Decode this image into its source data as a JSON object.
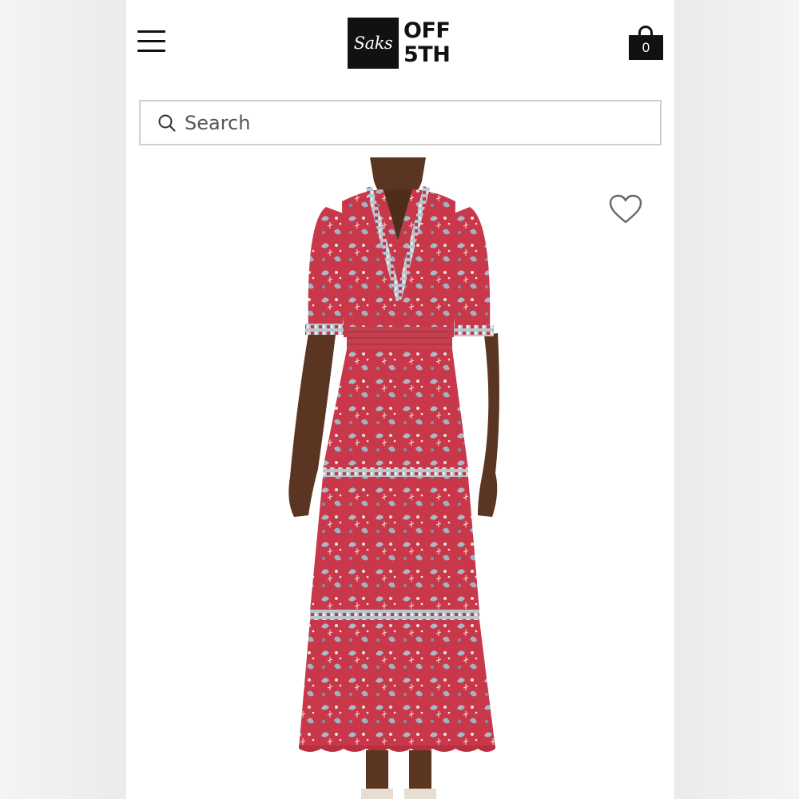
{
  "brand": {
    "logo_script": "Saks",
    "logo_line1": "OFF",
    "logo_line2": "5TH"
  },
  "header": {
    "menu_icon": "hamburger-menu-icon",
    "bag_icon": "shopping-bag-icon",
    "bag_count": "0"
  },
  "search": {
    "icon": "search-icon",
    "placeholder": "Search"
  },
  "product": {
    "favorite_icon": "heart-outline-icon",
    "image_subject": "model wearing a red floral tiered ruffle maxi dress"
  },
  "colors": {
    "dress": "#c8374a",
    "pattern": "#9fb2c0",
    "skin": "#5a3522",
    "text": "#111111",
    "border": "#d0d0d0"
  }
}
